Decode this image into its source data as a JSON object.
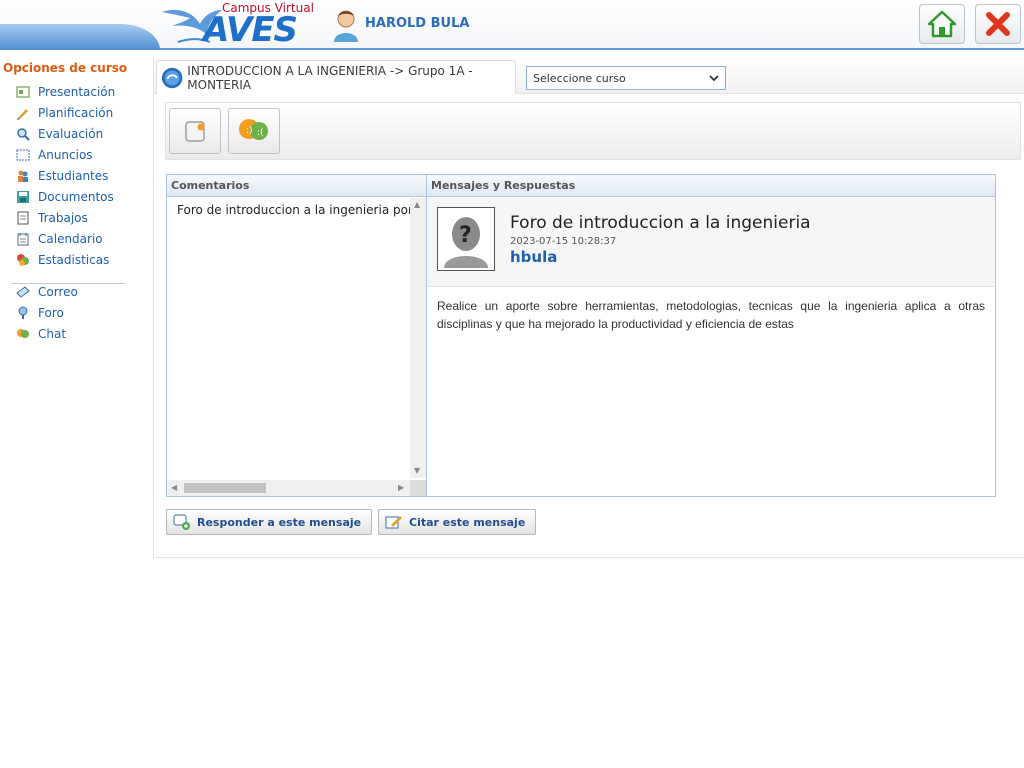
{
  "header": {
    "brand_top": "Campus Virtual",
    "brand_main": "AVES",
    "user_name": "HAROLD BULA",
    "home_icon": "home-icon",
    "close_icon": "close-icon"
  },
  "sidebar": {
    "title": "Opciones de curso",
    "items": [
      {
        "label": "Presentación",
        "icon": "presentation-icon"
      },
      {
        "label": "Planificación",
        "icon": "planning-icon"
      },
      {
        "label": "Evaluación",
        "icon": "evaluation-icon"
      },
      {
        "label": "Anuncios",
        "icon": "announcements-icon"
      },
      {
        "label": "Estudiantes",
        "icon": "students-icon"
      },
      {
        "label": "Documentos",
        "icon": "documents-icon"
      },
      {
        "label": "Trabajos",
        "icon": "assignments-icon"
      },
      {
        "label": "Calendario",
        "icon": "calendar-icon"
      },
      {
        "label": "Estadisticas",
        "icon": "statistics-icon"
      }
    ],
    "items2": [
      {
        "label": "Correo",
        "icon": "mail-icon"
      },
      {
        "label": "Foro",
        "icon": "forum-icon"
      },
      {
        "label": "Chat",
        "icon": "chat-icon"
      }
    ]
  },
  "course": {
    "title": "INTRODUCCION A LA INGENIERIA -> Grupo 1A - MONTERIA",
    "select_value": "Seleccione curso"
  },
  "comments": {
    "header": "Comentarios",
    "items": [
      "Foro de introduccion a la ingenieria por hbula"
    ]
  },
  "messages": {
    "header": "Mensajes y Respuestas",
    "title": "Foro de introduccion a la ingenieria",
    "date": "2023-07-15 10:28:37",
    "author": "hbula",
    "body": "Realice un aporte sobre herramientas, metodologias, tecnicas que la ingenieria aplica a otras disciplinas y que ha mejorado la productividad y eficiencia de estas"
  },
  "actions": {
    "reply_label": "Responder a este mensaje",
    "quote_label": "Citar este mensaje"
  },
  "colors": {
    "accent": "#1f5fae",
    "sidebar_title": "#e05a10",
    "header_bar": "#5b9be0"
  }
}
